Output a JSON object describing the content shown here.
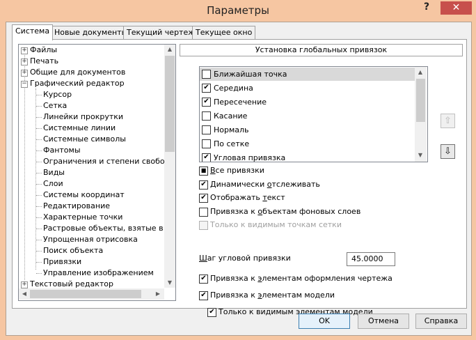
{
  "window": {
    "title": "Параметры",
    "help_glyph": "?",
    "close_glyph": "✕"
  },
  "tabs": [
    {
      "label": "Система",
      "active": true
    },
    {
      "label": "Новые документы"
    },
    {
      "label": "Текущий чертеж"
    },
    {
      "label": "Текущее окно"
    }
  ],
  "tree": {
    "items": [
      {
        "label": "Файлы",
        "expander": "+"
      },
      {
        "label": "Печать",
        "expander": "+"
      },
      {
        "label": "Общие для документов",
        "expander": "+"
      },
      {
        "label": "Графический редактор",
        "expander": "−"
      },
      {
        "label": "Курсор"
      },
      {
        "label": "Сетка"
      },
      {
        "label": "Линейки прокрутки"
      },
      {
        "label": "Системные линии"
      },
      {
        "label": "Системные символы"
      },
      {
        "label": "Фантомы"
      },
      {
        "label": "Ограничения и степени свобода"
      },
      {
        "label": "Виды"
      },
      {
        "label": "Слои"
      },
      {
        "label": "Системы координат"
      },
      {
        "label": "Редактирование"
      },
      {
        "label": "Характерные точки"
      },
      {
        "label": "Растровые объекты, взятые в д"
      },
      {
        "label": "Упрощенная отрисовка"
      },
      {
        "label": "Поиск объекта"
      },
      {
        "label": "Привязки",
        "selected": true
      },
      {
        "label": "Управление изображением"
      },
      {
        "label": "Текстовый редактор",
        "expander": "+"
      }
    ]
  },
  "panel": {
    "header": "Установка глобальных привязок",
    "snaps": [
      {
        "label": "Ближайшая точка",
        "checked": false,
        "selected": true
      },
      {
        "label": "Середина",
        "checked": true
      },
      {
        "label": "Пересечение",
        "checked": true
      },
      {
        "label": "Касание",
        "checked": false
      },
      {
        "label": "Нормаль",
        "checked": false
      },
      {
        "label": "По сетке",
        "checked": false
      },
      {
        "label": "Угловая привязка",
        "checked": true
      }
    ],
    "check_glyph": "✔",
    "square_glyph": "■",
    "move_up_glyph": "⇧",
    "move_down_glyph": "⇩",
    "options": {
      "all_snaps": {
        "u": "В",
        "rest": "се привязки"
      },
      "dynamic_tracking": {
        "pre": "Динамически ",
        "u": "о",
        "rest": "тслеживать"
      },
      "show_text": {
        "pre": "Отображать ",
        "u": "т",
        "rest": "екст"
      },
      "bg_layers": {
        "pre": "Привязка к ",
        "u": "о",
        "rest": "бъектам фоновых слоев"
      },
      "visible_grid": {
        "label": "Только к видимым точкам сетки"
      },
      "angle_step_label": {
        "u": "Ш",
        "rest": "аг угловой привязки"
      },
      "angle_step_value": "45.0000",
      "design_elements": {
        "pre": "Привязка к ",
        "u": "э",
        "rest": "лементам оформления чертежа"
      },
      "model_elements": {
        "pre": "Привязка к ",
        "u": "э",
        "rest": "лементам модели"
      },
      "visible_model": {
        "label": "Только к видимым элементам модели"
      }
    }
  },
  "buttons": {
    "ok": "OK",
    "cancel": "Отмена",
    "help": "Справка"
  }
}
